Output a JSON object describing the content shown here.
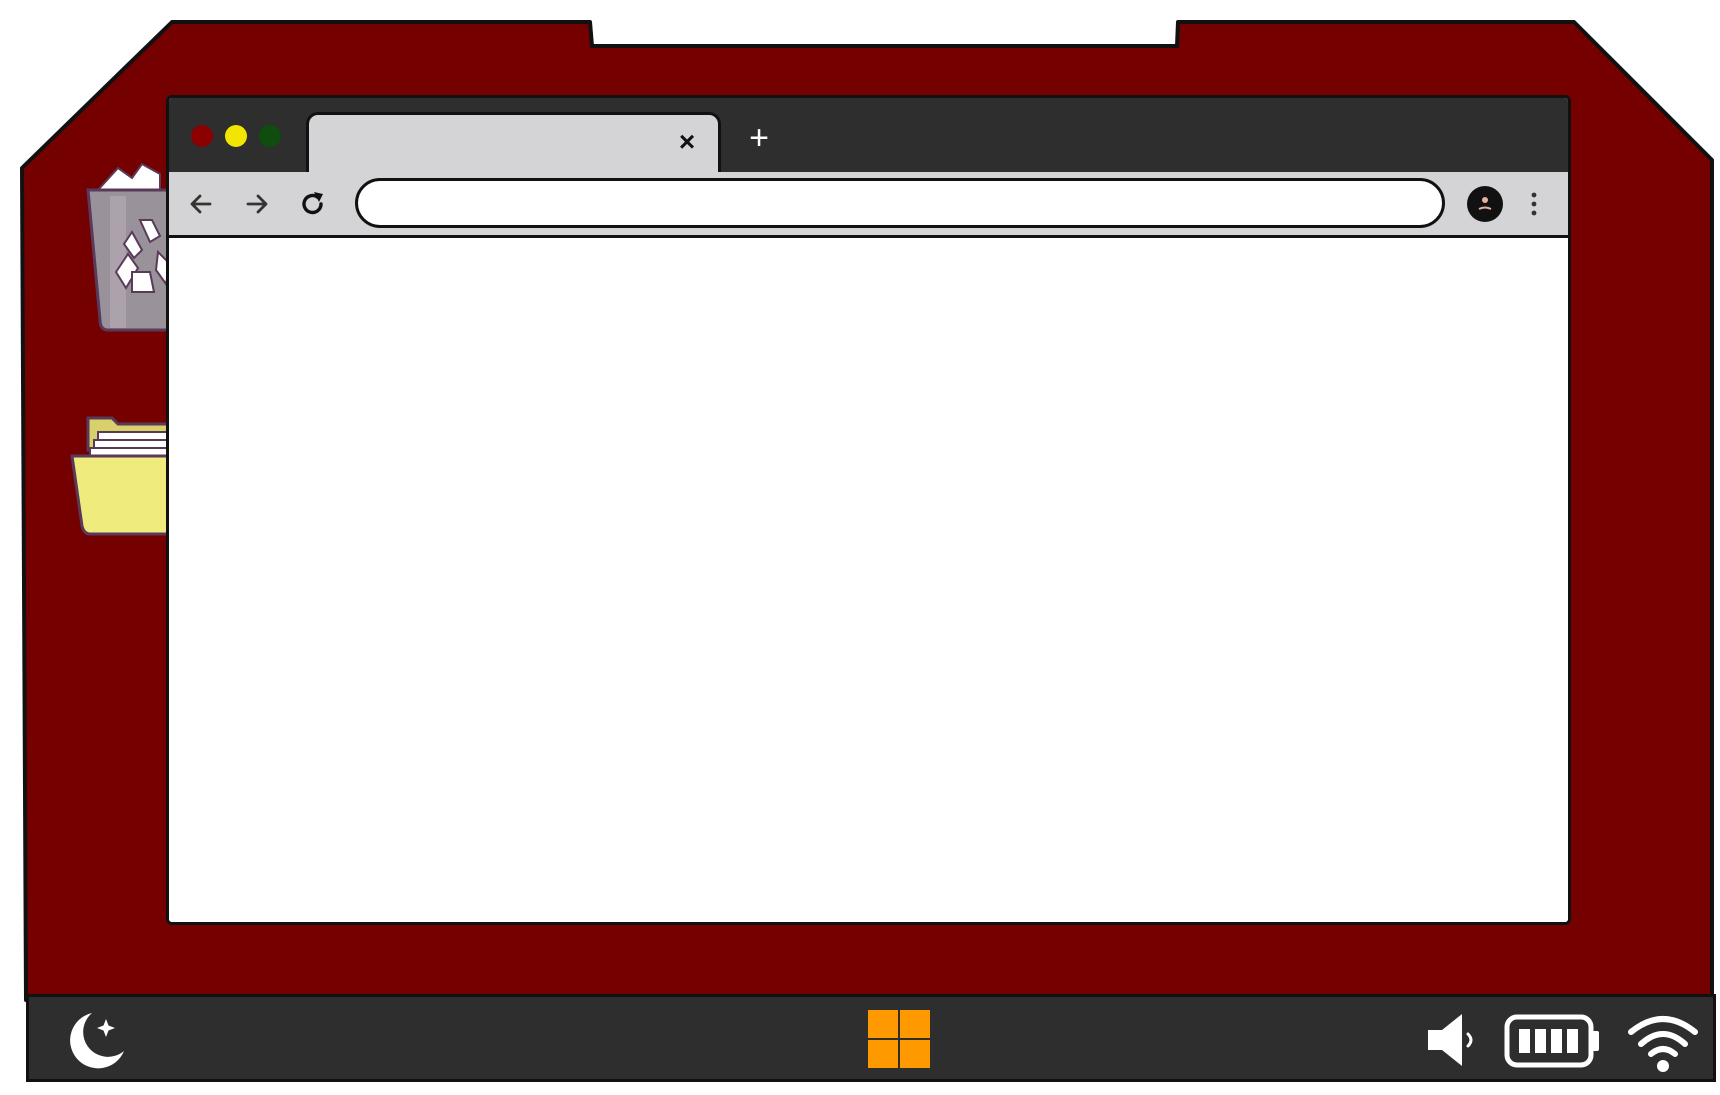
{
  "colors": {
    "desktop_bg": "#740000",
    "browser_chrome_dark": "#2e2e2e",
    "browser_chrome_light": "#d4d4d6",
    "taskbar_bg": "#2e2e2e",
    "start_button": "#ff9900",
    "traffic_close": "#8b0000",
    "traffic_minimize": "#f2e600",
    "traffic_maximize": "#0f4d0f",
    "recycle_bin": "#9a929a",
    "folder": "#efeb7c"
  },
  "desktop": {
    "icons": [
      {
        "name": "recycle-bin-icon"
      },
      {
        "name": "folder-icon"
      }
    ]
  },
  "browser": {
    "tab": {
      "title": "",
      "close_symbol": "×"
    },
    "new_tab_symbol": "+",
    "address_bar": {
      "value": "",
      "placeholder": ""
    },
    "icons": {
      "back": "arrow-left-icon",
      "forward": "arrow-right-icon",
      "reload": "reload-icon",
      "profile": "profile-avatar-icon",
      "menu": "more-vertical-icon"
    }
  },
  "taskbar": {
    "left": "night-mode-icon",
    "center": "start-menu-icon",
    "right": [
      "volume-icon",
      "battery-icon",
      "wifi-icon"
    ],
    "battery_level": 1.0
  }
}
